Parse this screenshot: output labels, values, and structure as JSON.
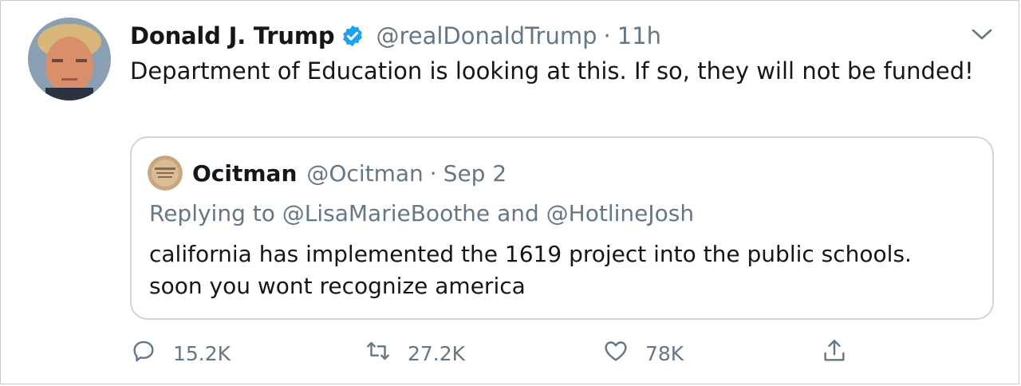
{
  "tweet": {
    "author_name": "Donald J. Trump",
    "handle": "@realDonaldTrump",
    "separator": "·",
    "time": "11h",
    "text": "Department of Education is looking at this. If so, they will not be funded!"
  },
  "quoted_tweet": {
    "author_name": "Ocitman",
    "handle": "@Ocitman",
    "separator": "·",
    "time": "Sep 2",
    "replying_prefix": "Replying to",
    "mention_1": "@LisaMarieBoothe",
    "conjunction": "and",
    "mention_2": "@HotlineJosh",
    "text": "california has implemented the 1619 project into the public schools. soon you wont recognize america"
  },
  "actions": {
    "reply_count": "15.2K",
    "retweet_count": "27.2K",
    "like_count": "78K"
  },
  "colors": {
    "text_primary": "#14171a",
    "text_secondary": "#657786",
    "verified_blue": "#1da1f2",
    "border": "#ccd6dd"
  },
  "icons": [
    "verified-badge-icon",
    "chevron-down-icon",
    "reply-icon",
    "retweet-icon",
    "like-icon",
    "share-icon"
  ]
}
